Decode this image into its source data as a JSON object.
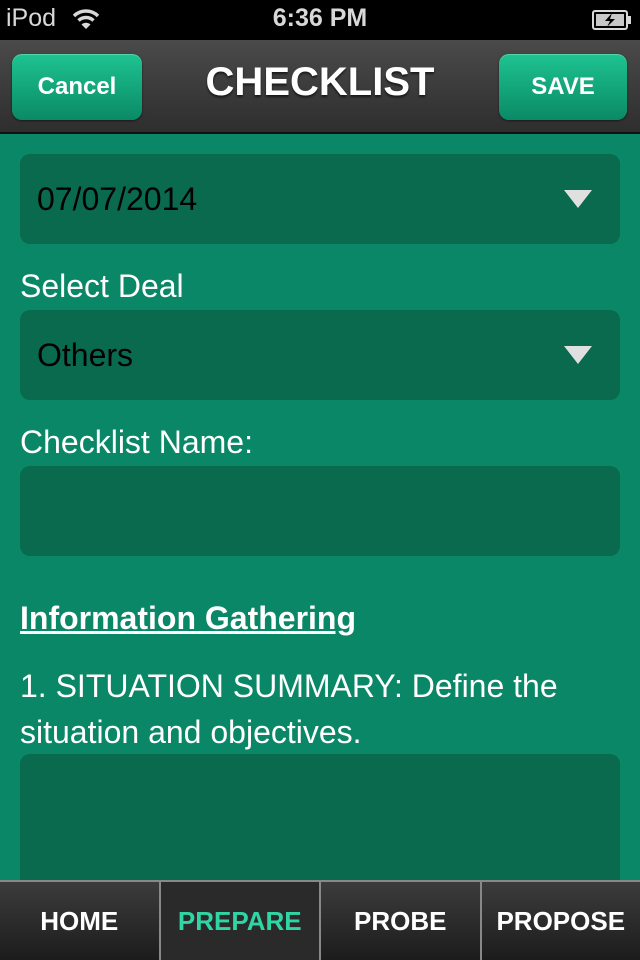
{
  "status_bar": {
    "carrier": "iPod",
    "time": "6:36 PM",
    "wifi_icon": "wifi-icon",
    "battery_icon": "battery-charging-icon"
  },
  "nav_bar": {
    "title": "CHECKLIST",
    "cancel_label": "Cancel",
    "save_label": "SAVE"
  },
  "form": {
    "date": {
      "value": "07/07/2014",
      "icon": "dropdown-arrow-icon"
    },
    "deal": {
      "label": "Select Deal",
      "value": "Others",
      "icon": "dropdown-arrow-icon"
    },
    "checklist_name": {
      "label": "Checklist Name:",
      "value": ""
    },
    "section_title": "Information Gathering",
    "question_1": {
      "label": "1. SITUATION SUMMARY: Define the situation and objectives.",
      "value": ""
    }
  },
  "tab_bar": {
    "tabs": [
      {
        "label": "HOME",
        "active": false
      },
      {
        "label": "PREPARE",
        "active": true
      },
      {
        "label": "PROBE",
        "active": false
      },
      {
        "label": "PROPOSE",
        "active": false
      }
    ]
  },
  "colors": {
    "background": "#0a8766",
    "field": "#0a6a4d",
    "accent": "#2fd6a4",
    "button": "#14a97e"
  }
}
